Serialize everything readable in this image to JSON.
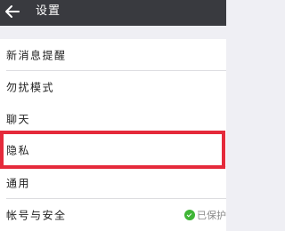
{
  "header": {
    "title": "设置",
    "back_icon": "back-arrow-icon",
    "background": "#393a3f"
  },
  "settings": {
    "items": [
      {
        "label": "新消息提醒"
      },
      {
        "label": "勿扰模式"
      },
      {
        "label": "聊天"
      },
      {
        "label": "隐私",
        "highlighted": true
      },
      {
        "label": "通用"
      },
      {
        "label": "帐号与安全",
        "status": "已保护",
        "status_icon": "shield-check-icon"
      }
    ]
  },
  "colors": {
    "highlight_border": "#e52a3b",
    "status_green": "#3fb536"
  }
}
